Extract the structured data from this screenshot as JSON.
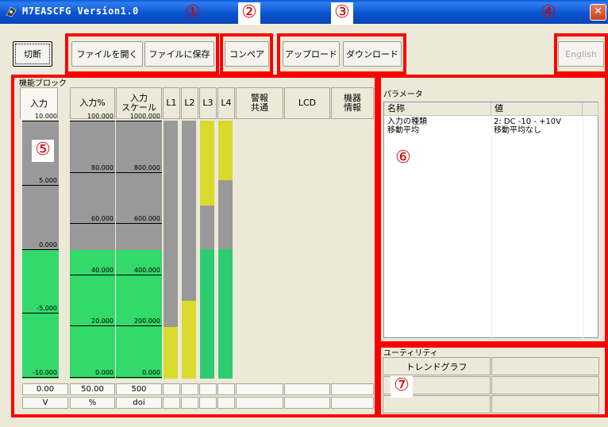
{
  "window": {
    "title": "M7EASCFG Version1.0",
    "close_glyph": "✕",
    "icon": "gear-app-icon"
  },
  "markers": [
    "①",
    "②",
    "③",
    "④",
    "⑤",
    "⑥",
    "⑦"
  ],
  "toolbar": {
    "disconnect": "切断",
    "open_file": "ファイルを開く",
    "save_file": "ファイルに保存",
    "compare": "コンペア",
    "upload": "アップロード",
    "download": "ダウンロード",
    "language": "English"
  },
  "function_block": {
    "label": "機能ブロック",
    "tabs": [
      "入力",
      "入力%",
      "入力\nスケール",
      "L1",
      "L2",
      "L3",
      "L4",
      "警報\n共通",
      "LCD",
      "機器\n情報"
    ]
  },
  "bars": {
    "input": {
      "ticks": [
        "10.000",
        "5.000",
        "0.000",
        "-5.000",
        "-10.000"
      ],
      "range": [
        -10,
        10
      ],
      "value": 0.0
    },
    "input_percent": {
      "ticks": [
        "100.000",
        "80.000",
        "60.000",
        "40.000",
        "20.000",
        "0.000"
      ],
      "range": [
        0,
        100
      ],
      "value": 50.0
    },
    "input_scale": {
      "ticks": [
        "1000.000",
        "800.000",
        "600.000",
        "400.000",
        "200.000",
        "0.000"
      ],
      "range": [
        0,
        1000
      ],
      "value": 500
    },
    "L1": {
      "fill": 0.2,
      "color": "#d9d92e"
    },
    "L2": {
      "fill": 0.3,
      "color": "#d9d92e"
    },
    "L3": {
      "fill": 0.5,
      "color": "#2ecc71",
      "top_fill": 0.33,
      "top_color": "#d9d92e"
    },
    "L4": {
      "fill": 0.5,
      "color": "#2ecc71",
      "top_fill": 0.23,
      "top_color": "#d9d92e"
    },
    "colors": {
      "gray": "#999999",
      "green": "#33d96b",
      "yellow": "#dddd33"
    }
  },
  "values": [
    "0.00",
    "50.00",
    "500"
  ],
  "units": [
    "V",
    "%",
    "doi"
  ],
  "parameters": {
    "label": "パラメータ",
    "col_name": "名称",
    "col_value": "値",
    "rows": [
      {
        "name": "入力の種類",
        "value": "2: DC -10 - +10V"
      },
      {
        "name": "移動平均",
        "value": "移動平均なし"
      }
    ]
  },
  "utility": {
    "label": "ユーティリティ",
    "trend_graph": "トレンドグラフ"
  }
}
